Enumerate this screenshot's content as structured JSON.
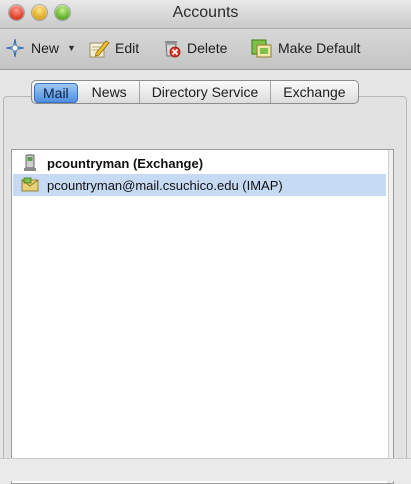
{
  "window": {
    "title": "Accounts"
  },
  "toolbar": {
    "new_label": "New",
    "edit_label": "Edit",
    "delete_label": "Delete",
    "make_default_label": "Make Default"
  },
  "tabs": [
    {
      "label": "Mail",
      "selected": true
    },
    {
      "label": "News",
      "selected": false
    },
    {
      "label": "Directory Service",
      "selected": false
    },
    {
      "label": "Exchange",
      "selected": false
    }
  ],
  "accounts": [
    {
      "name": "pcountryman (Exchange)",
      "icon": "exchange-server-icon",
      "bold": true,
      "selected": false
    },
    {
      "name": "pcountryman@mail.csuchico.edu (IMAP)",
      "icon": "imap-mailbox-icon",
      "bold": false,
      "selected": true
    }
  ],
  "colors": {
    "selection": "#c6daf4",
    "active_tab": "#4e8fe0"
  }
}
